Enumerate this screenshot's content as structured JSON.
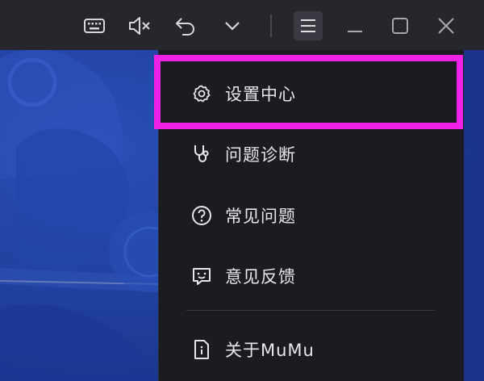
{
  "toolbar": {
    "buttons": [
      {
        "name": "keyboard-icon"
      },
      {
        "name": "mute-icon"
      },
      {
        "name": "undo-icon"
      },
      {
        "name": "chevron-down-icon"
      },
      {
        "name": "menu-icon"
      },
      {
        "name": "minimize-icon"
      },
      {
        "name": "maximize-icon"
      },
      {
        "name": "close-icon"
      }
    ]
  },
  "menu": {
    "items": [
      {
        "label": "设置中心",
        "icon": "gear-icon",
        "highlighted": true
      },
      {
        "label": "问题诊断",
        "icon": "stethoscope-icon"
      },
      {
        "label": "常见问题",
        "icon": "question-icon"
      },
      {
        "label": "意见反馈",
        "icon": "feedback-icon"
      },
      {
        "label": "关于MuMu",
        "icon": "info-document-icon"
      }
    ]
  },
  "colors": {
    "titlebar": "#26272c",
    "menu_bg": "#1b1c22",
    "game_bg": "#1f3d9c",
    "highlight": "#f021e6",
    "text": "#e8e8ea"
  }
}
